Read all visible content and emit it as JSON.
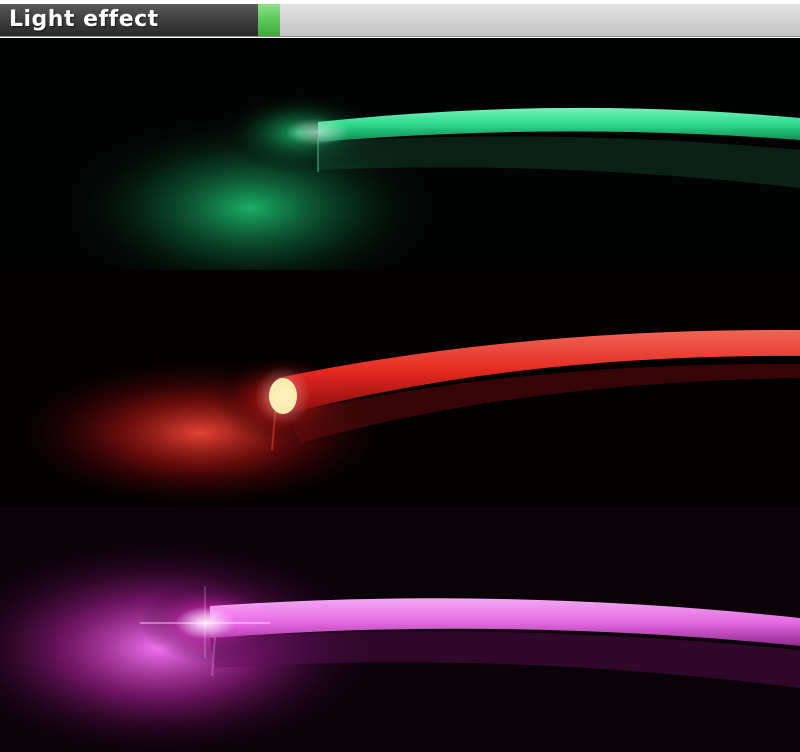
{
  "header": {
    "title": "Light effect",
    "colors": {
      "dark_block": "#3c3c3c",
      "accent": "#5ac956",
      "bar": "#d2d2d2"
    }
  },
  "photo": {
    "panels": [
      {
        "name": "green-glow-panel",
        "color": "#22e38a"
      },
      {
        "name": "red-glow-panel",
        "color": "#ff3030"
      },
      {
        "name": "pink-glow-panel",
        "color": "#f060e8"
      }
    ]
  }
}
